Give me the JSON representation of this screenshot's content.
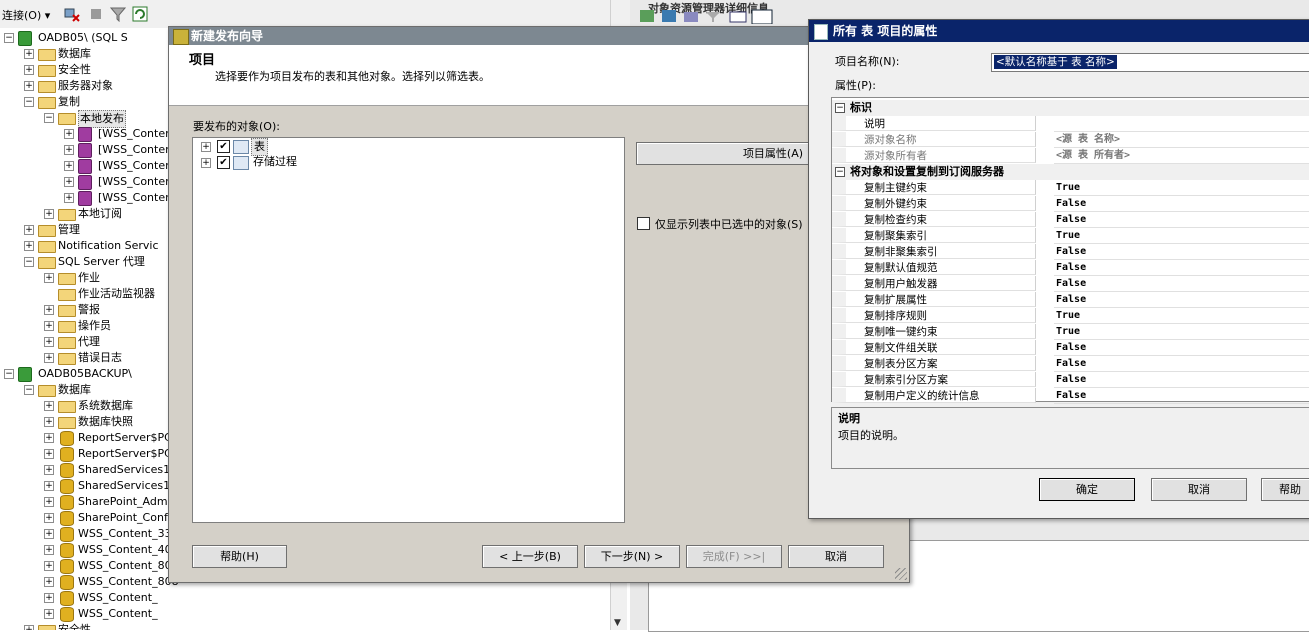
{
  "object_explorer": {
    "connect_label": "连接(O)",
    "connect_arrow": "▾",
    "tree": [
      {
        "label": "OADB05\\           (SQL S",
        "indent": 0,
        "exp": "−",
        "icon": "server"
      },
      {
        "label": "数据库",
        "indent": 1,
        "exp": "+",
        "icon": "folder"
      },
      {
        "label": "安全性",
        "indent": 1,
        "exp": "+",
        "icon": "folder"
      },
      {
        "label": "服务器对象",
        "indent": 1,
        "exp": "+",
        "icon": "folder"
      },
      {
        "label": "复制",
        "indent": 1,
        "exp": "−",
        "icon": "folder"
      },
      {
        "label": "本地发布",
        "indent": 2,
        "exp": "−",
        "icon": "folder",
        "selected": true
      },
      {
        "label": "[WSS_Content",
        "indent": 3,
        "exp": "+",
        "icon": "pub"
      },
      {
        "label": "[WSS_Content",
        "indent": 3,
        "exp": "+",
        "icon": "pub"
      },
      {
        "label": "[WSS_Content",
        "indent": 3,
        "exp": "+",
        "icon": "pub"
      },
      {
        "label": "[WSS_Content",
        "indent": 3,
        "exp": "+",
        "icon": "pub"
      },
      {
        "label": "[WSS_Content",
        "indent": 3,
        "exp": "+",
        "icon": "pub"
      },
      {
        "label": "本地订阅",
        "indent": 2,
        "exp": "+",
        "icon": "folder"
      },
      {
        "label": "管理",
        "indent": 1,
        "exp": "+",
        "icon": "folder"
      },
      {
        "label": "Notification Servic",
        "indent": 1,
        "exp": "+",
        "icon": "folder"
      },
      {
        "label": "SQL Server 代理",
        "indent": 1,
        "exp": "−",
        "icon": "agent"
      },
      {
        "label": "作业",
        "indent": 2,
        "exp": "+",
        "icon": "folder"
      },
      {
        "label": "作业活动监视器",
        "indent": 2,
        "exp": "",
        "icon": "monitor"
      },
      {
        "label": "警报",
        "indent": 2,
        "exp": "+",
        "icon": "folder"
      },
      {
        "label": "操作员",
        "indent": 2,
        "exp": "+",
        "icon": "folder"
      },
      {
        "label": "代理",
        "indent": 2,
        "exp": "+",
        "icon": "folder"
      },
      {
        "label": "错误日志",
        "indent": 2,
        "exp": "+",
        "icon": "folder"
      },
      {
        "label": "OADB05BACKUP\\",
        "indent": 0,
        "exp": "−",
        "icon": "server"
      },
      {
        "label": "数据库",
        "indent": 1,
        "exp": "−",
        "icon": "folder"
      },
      {
        "label": "系统数据库",
        "indent": 2,
        "exp": "+",
        "icon": "folder"
      },
      {
        "label": "数据库快照",
        "indent": 2,
        "exp": "+",
        "icon": "folder"
      },
      {
        "label": "ReportServer$PC",
        "indent": 2,
        "exp": "+",
        "icon": "db"
      },
      {
        "label": "ReportServer$PC",
        "indent": 2,
        "exp": "+",
        "icon": "db"
      },
      {
        "label": "SharedServices1_",
        "indent": 2,
        "exp": "+",
        "icon": "db"
      },
      {
        "label": "SharedServices1_",
        "indent": 2,
        "exp": "+",
        "icon": "db"
      },
      {
        "label": "SharePoint_Admir",
        "indent": 2,
        "exp": "+",
        "icon": "db"
      },
      {
        "label": "SharePoint_Conf:",
        "indent": 2,
        "exp": "+",
        "icon": "db"
      },
      {
        "label": "WSS_Content_333",
        "indent": 2,
        "exp": "+",
        "icon": "db"
      },
      {
        "label": "WSS_Content_409",
        "indent": 2,
        "exp": "+",
        "icon": "db"
      },
      {
        "label": "WSS_Content_80",
        "indent": 2,
        "exp": "+",
        "icon": "db"
      },
      {
        "label": "WSS_Content_808",
        "indent": 2,
        "exp": "+",
        "icon": "db"
      },
      {
        "label": "WSS_Content_",
        "indent": 2,
        "exp": "+",
        "icon": "db"
      },
      {
        "label": "WSS_Content_",
        "indent": 2,
        "exp": "+",
        "icon": "db"
      },
      {
        "label": "安全性",
        "indent": 1,
        "exp": "+",
        "icon": "folder"
      }
    ]
  },
  "background_panel": {
    "title": "对象资源管理器详细信息"
  },
  "wizard": {
    "title": "新建发布向导",
    "header_title": "项目",
    "header_desc": "选择要作为项目发布的表和其他对象。选择列以筛选表。",
    "objects_label": "要发布的对象(O):",
    "objects": [
      {
        "label": "表",
        "checked": "✔",
        "expander": "+"
      },
      {
        "label": "存储过程",
        "checked": "✔",
        "expander": "+"
      }
    ],
    "article_props_button": "项目属性(A)",
    "only_selected_label": "仅显示列表中已选中的对象(S)",
    "help_button": "帮助(H)",
    "back_button": "< 上一步(B)",
    "next_button": "下一步(N) >",
    "finish_button": "完成(F) >>|",
    "cancel_button": "取消"
  },
  "props": {
    "title": "所有 表 项目的属性",
    "name_label": "项目名称(N):",
    "name_value": "<默认名称基于 表 名称>",
    "attrs_label": "属性(P):",
    "categories": [
      {
        "name": "标识",
        "expander": "−",
        "rows": [
          {
            "name": "说明",
            "value": "",
            "disabled": false
          },
          {
            "name": "源对象名称",
            "value": "<源 表 名称>",
            "disabled": true
          },
          {
            "name": "源对象所有者",
            "value": "<源 表 所有者>",
            "disabled": true
          }
        ]
      },
      {
        "name": "将对象和设置复制到订阅服务器",
        "expander": "−",
        "rows": [
          {
            "name": "复制主键约束",
            "value": "True"
          },
          {
            "name": "复制外键约束",
            "value": "False"
          },
          {
            "name": "复制检查约束",
            "value": "False"
          },
          {
            "name": "复制聚集索引",
            "value": "True"
          },
          {
            "name": "复制非聚集索引",
            "value": "False"
          },
          {
            "name": "复制默认值规范",
            "value": "False"
          },
          {
            "name": "复制用户触发器",
            "value": "False"
          },
          {
            "name": "复制扩展属性",
            "value": "False"
          },
          {
            "name": "复制排序规则",
            "value": "True"
          },
          {
            "name": "复制唯一键约束",
            "value": "True"
          },
          {
            "name": "复制文件组关联",
            "value": "False"
          },
          {
            "name": "复制表分区方案",
            "value": "False"
          },
          {
            "name": "复制索引分区方案",
            "value": "False"
          },
          {
            "name": "复制用户定义的统计信息",
            "value": "False"
          }
        ]
      }
    ],
    "desc_title": "说明",
    "desc_text": "项目的说明。",
    "ok_button": "确定",
    "cancel_button": "取消",
    "help_button": "帮助"
  }
}
